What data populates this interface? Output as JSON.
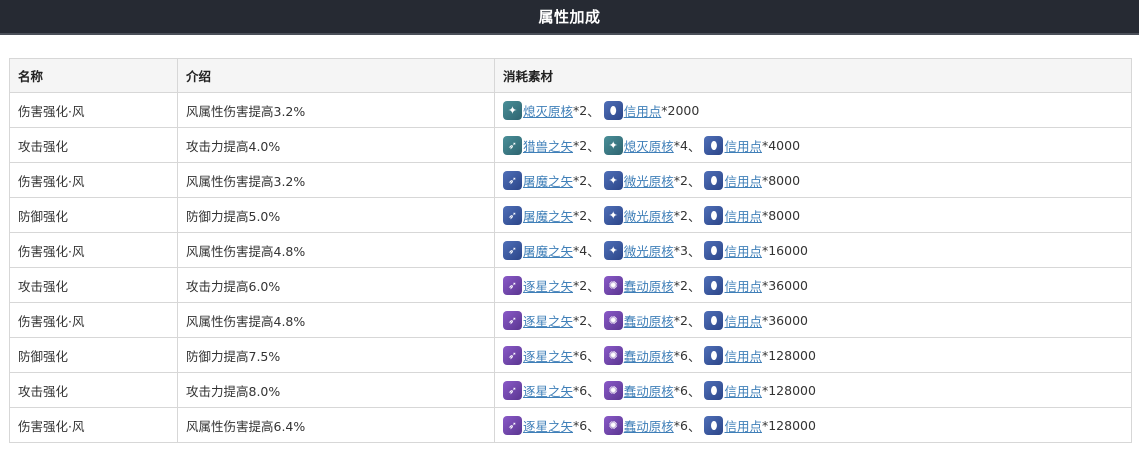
{
  "header": {
    "title": "属性加成"
  },
  "table": {
    "columns": [
      "名称",
      "介绍",
      "消耗素材"
    ],
    "rows": [
      {
        "name": "伤害强化·风",
        "desc": "风属性伤害提高3.2%",
        "materials": [
          {
            "icon": "destroyer-core-icon",
            "tier": "teal",
            "glyph": "✦",
            "label": "熄灭原核",
            "qty": "*2",
            "sep": "、"
          },
          {
            "icon": "credit-icon",
            "tier": "blue",
            "glyph": "⬮",
            "label": "信用点",
            "qty": "*2000",
            "sep": ""
          }
        ]
      },
      {
        "name": "攻击强化",
        "desc": "攻击力提高4.0%",
        "materials": [
          {
            "icon": "hunter-arrow-icon",
            "tier": "teal",
            "glyph": "➶",
            "label": "猎兽之矢",
            "qty": "*2",
            "sep": "、"
          },
          {
            "icon": "destroyer-core-icon",
            "tier": "teal",
            "glyph": "✦",
            "label": "熄灭原核",
            "qty": "*4",
            "sep": "、"
          },
          {
            "icon": "credit-icon",
            "tier": "blue",
            "glyph": "⬮",
            "label": "信用点",
            "qty": "*4000",
            "sep": ""
          }
        ]
      },
      {
        "name": "伤害强化·风",
        "desc": "风属性伤害提高3.2%",
        "materials": [
          {
            "icon": "demon-arrow-icon",
            "tier": "blue",
            "glyph": "➶",
            "label": "屠魔之矢",
            "qty": "*2",
            "sep": "、"
          },
          {
            "icon": "glimmer-core-icon",
            "tier": "blue",
            "glyph": "✦",
            "label": "微光原核",
            "qty": "*2",
            "sep": "、"
          },
          {
            "icon": "credit-icon",
            "tier": "blue",
            "glyph": "⬮",
            "label": "信用点",
            "qty": "*8000",
            "sep": ""
          }
        ]
      },
      {
        "name": "防御强化",
        "desc": "防御力提高5.0%",
        "materials": [
          {
            "icon": "demon-arrow-icon",
            "tier": "blue",
            "glyph": "➶",
            "label": "屠魔之矢",
            "qty": "*2",
            "sep": "、"
          },
          {
            "icon": "glimmer-core-icon",
            "tier": "blue",
            "glyph": "✦",
            "label": "微光原核",
            "qty": "*2",
            "sep": "、"
          },
          {
            "icon": "credit-icon",
            "tier": "blue",
            "glyph": "⬮",
            "label": "信用点",
            "qty": "*8000",
            "sep": ""
          }
        ]
      },
      {
        "name": "伤害强化·风",
        "desc": "风属性伤害提高4.8%",
        "materials": [
          {
            "icon": "demon-arrow-icon",
            "tier": "blue",
            "glyph": "➶",
            "label": "屠魔之矢",
            "qty": "*4",
            "sep": "、"
          },
          {
            "icon": "glimmer-core-icon",
            "tier": "blue",
            "glyph": "✦",
            "label": "微光原核",
            "qty": "*3",
            "sep": "、"
          },
          {
            "icon": "credit-icon",
            "tier": "blue",
            "glyph": "⬮",
            "label": "信用点",
            "qty": "*16000",
            "sep": ""
          }
        ]
      },
      {
        "name": "攻击强化",
        "desc": "攻击力提高6.0%",
        "materials": [
          {
            "icon": "star-chaser-arrow-icon",
            "tier": "purple",
            "glyph": "➶",
            "label": "逐星之矢",
            "qty": "*2",
            "sep": "、"
          },
          {
            "icon": "stirring-core-icon",
            "tier": "purple",
            "glyph": "✺",
            "label": "蠢动原核",
            "qty": "*2",
            "sep": "、"
          },
          {
            "icon": "credit-icon",
            "tier": "blue",
            "glyph": "⬮",
            "label": "信用点",
            "qty": "*36000",
            "sep": ""
          }
        ]
      },
      {
        "name": "伤害强化·风",
        "desc": "风属性伤害提高4.8%",
        "materials": [
          {
            "icon": "star-chaser-arrow-icon",
            "tier": "purple",
            "glyph": "➶",
            "label": "逐星之矢",
            "qty": "*2",
            "sep": "、"
          },
          {
            "icon": "stirring-core-icon",
            "tier": "purple",
            "glyph": "✺",
            "label": "蠢动原核",
            "qty": "*2",
            "sep": "、"
          },
          {
            "icon": "credit-icon",
            "tier": "blue",
            "glyph": "⬮",
            "label": "信用点",
            "qty": "*36000",
            "sep": ""
          }
        ]
      },
      {
        "name": "防御强化",
        "desc": "防御力提高7.5%",
        "materials": [
          {
            "icon": "star-chaser-arrow-icon",
            "tier": "purple",
            "glyph": "➶",
            "label": "逐星之矢",
            "qty": "*6",
            "sep": "、"
          },
          {
            "icon": "stirring-core-icon",
            "tier": "purple",
            "glyph": "✺",
            "label": "蠢动原核",
            "qty": "*6",
            "sep": "、"
          },
          {
            "icon": "credit-icon",
            "tier": "blue",
            "glyph": "⬮",
            "label": "信用点",
            "qty": "*128000",
            "sep": ""
          }
        ]
      },
      {
        "name": "攻击强化",
        "desc": "攻击力提高8.0%",
        "materials": [
          {
            "icon": "star-chaser-arrow-icon",
            "tier": "purple",
            "glyph": "➶",
            "label": "逐星之矢",
            "qty": "*6",
            "sep": "、"
          },
          {
            "icon": "stirring-core-icon",
            "tier": "purple",
            "glyph": "✺",
            "label": "蠢动原核",
            "qty": "*6",
            "sep": "、"
          },
          {
            "icon": "credit-icon",
            "tier": "blue",
            "glyph": "⬮",
            "label": "信用点",
            "qty": "*128000",
            "sep": ""
          }
        ]
      },
      {
        "name": "伤害强化·风",
        "desc": "风属性伤害提高6.4%",
        "materials": [
          {
            "icon": "star-chaser-arrow-icon",
            "tier": "purple",
            "glyph": "➶",
            "label": "逐星之矢",
            "qty": "*6",
            "sep": "、"
          },
          {
            "icon": "stirring-core-icon",
            "tier": "purple",
            "glyph": "✺",
            "label": "蠢动原核",
            "qty": "*6",
            "sep": "、"
          },
          {
            "icon": "credit-icon",
            "tier": "blue",
            "glyph": "⬮",
            "label": "信用点",
            "qty": "*128000",
            "sep": ""
          }
        ]
      }
    ]
  },
  "colors": {
    "header_bg": "#262a33",
    "link": "#3f7fb8",
    "table_border": "#d7d7d7",
    "table_header_bg": "#f5f5f5"
  }
}
